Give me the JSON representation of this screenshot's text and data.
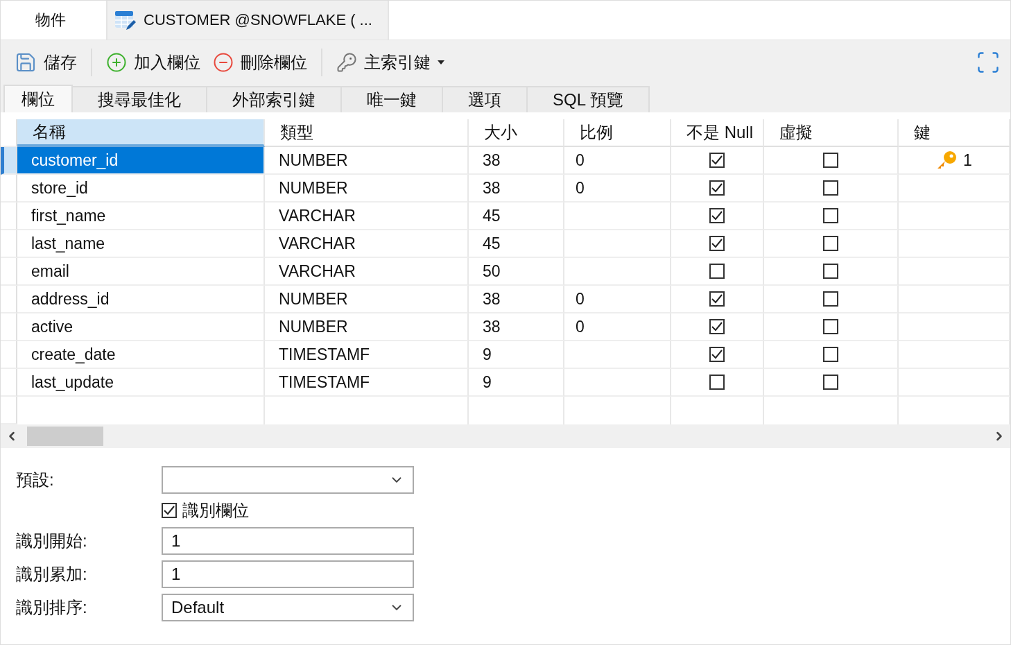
{
  "window_tabs": [
    {
      "label": "物件",
      "kind": "plain",
      "selected": false
    },
    {
      "label": "CUSTOMER @SNOWFLAKE ( ...",
      "kind": "table",
      "selected": true
    }
  ],
  "toolbar": [
    {
      "label": "儲存",
      "kind": "save"
    },
    {
      "label": "加入欄位",
      "kind": "add"
    },
    {
      "label": "刪除欄位",
      "kind": "remove"
    },
    {
      "label": "主索引鍵",
      "kind": "key"
    }
  ],
  "subtabs": [
    {
      "label": "欄位",
      "selected": true
    },
    {
      "label": "搜尋最佳化",
      "selected": false
    },
    {
      "label": "外部索引鍵",
      "selected": false
    },
    {
      "label": "唯一鍵",
      "selected": false
    },
    {
      "label": "選項",
      "selected": false
    },
    {
      "label": "SQL 預覽",
      "selected": false
    }
  ],
  "table": {
    "columns": [
      {
        "label": "名稱",
        "selected": true
      },
      {
        "label": "類型",
        "selected": false
      },
      {
        "label": "大小",
        "selected": false
      },
      {
        "label": "比例",
        "selected": false
      },
      {
        "label": "不是 Null",
        "selected": false
      },
      {
        "label": "虛擬",
        "selected": false
      },
      {
        "label": "鍵",
        "selected": false
      }
    ],
    "rows": [
      {
        "name": "customer_id",
        "type": "NUMBER",
        "size": "38",
        "scale": "0",
        "not_null": true,
        "virtual": false,
        "key": "1",
        "selected": true
      },
      {
        "name": "store_id",
        "type": "NUMBER",
        "size": "38",
        "scale": "0",
        "not_null": true,
        "virtual": false,
        "selected": false
      },
      {
        "name": "first_name",
        "type": "VARCHAR",
        "size": "45",
        "not_null": true,
        "virtual": false,
        "selected": false
      },
      {
        "name": "last_name",
        "type": "VARCHAR",
        "size": "45",
        "not_null": true,
        "virtual": false,
        "selected": false
      },
      {
        "name": "email",
        "type": "VARCHAR",
        "size": "50",
        "not_null": false,
        "virtual": false,
        "selected": false
      },
      {
        "name": "address_id",
        "type": "NUMBER",
        "size": "38",
        "scale": "0",
        "not_null": true,
        "virtual": false,
        "selected": false
      },
      {
        "name": "active",
        "type": "NUMBER",
        "size": "38",
        "scale": "0",
        "not_null": true,
        "virtual": false,
        "selected": false
      },
      {
        "name": "create_date",
        "type": "TIMESTAMF",
        "size": "9",
        "not_null": true,
        "virtual": false,
        "selected": false
      },
      {
        "name": "last_update",
        "type": "TIMESTAMF",
        "size": "9",
        "not_null": false,
        "virtual": false,
        "selected": false
      }
    ]
  },
  "form": {
    "default_label": "預設:",
    "identity": {
      "label": "識別欄位",
      "checked": true
    },
    "fields": [
      {
        "label": "識別開始:",
        "value": "1",
        "kind": "text"
      },
      {
        "label": "識別累加:",
        "value": "1",
        "kind": "text"
      },
      {
        "label": "識別排序:",
        "value": "Default",
        "kind": "select"
      }
    ]
  }
}
